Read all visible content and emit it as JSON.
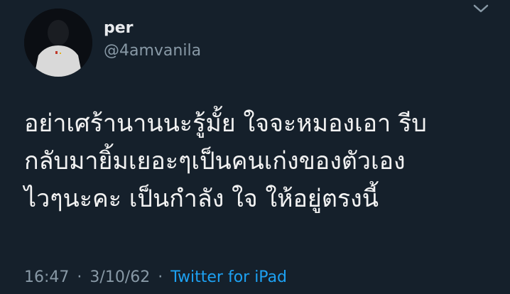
{
  "author": {
    "display_name": "per",
    "username": "@4amvanila"
  },
  "tweet": {
    "lines": [
      "อย่าเศร้านานนะรู้มั้ย  ใจจะหมองเอา รีบ",
      "กลับมายิ้มเยอะๆเป็นคนเก่งของตัวเอง",
      "ไวๆนะคะ เป็นกำลัง ใจ ให้อยู่ตรงนี้"
    ]
  },
  "meta": {
    "time": "16:47",
    "separator": "·",
    "date": "3/10/62",
    "source": "Twitter for iPad"
  },
  "icons": {
    "menu": "chevron-down-icon"
  },
  "colors": {
    "background": "#15202b",
    "text": "#f2f2f2",
    "secondary": "#8899a6",
    "link": "#1da1f2"
  }
}
